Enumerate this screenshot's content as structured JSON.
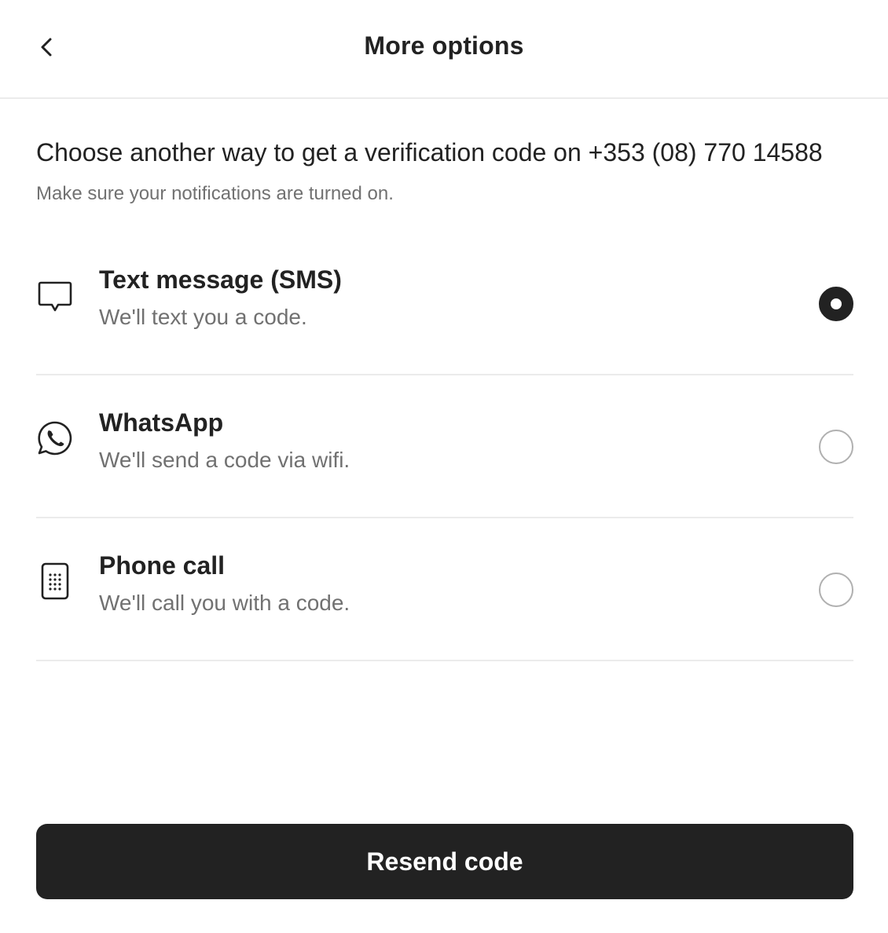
{
  "header": {
    "title": "More options",
    "back_icon": "chevron-left-icon"
  },
  "intro": {
    "heading": "Choose another way to get a verification code on +353 (08) 770 14588",
    "subtext": "Make sure your notifications are turned on."
  },
  "options": [
    {
      "title": "Text message (SMS)",
      "description": "We'll text you a code.",
      "icon": "message-bubble-icon",
      "selected": true
    },
    {
      "title": "WhatsApp",
      "description": "We'll send a code via wifi.",
      "icon": "whatsapp-icon",
      "selected": false
    },
    {
      "title": "Phone call",
      "description": "We'll call you with a code.",
      "icon": "phone-keypad-icon",
      "selected": false
    }
  ],
  "cta": {
    "label": "Resend code"
  },
  "colors": {
    "text": "#222222",
    "muted": "#717171",
    "divider": "#ebebeb",
    "button": "#222222"
  }
}
